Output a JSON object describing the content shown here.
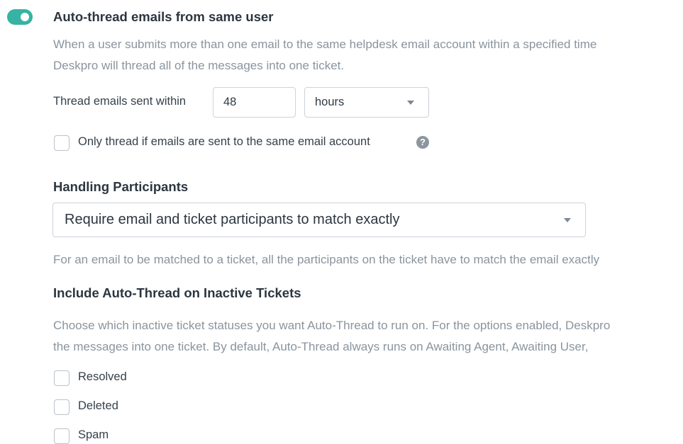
{
  "auto_thread": {
    "enabled": true,
    "title": "Auto-thread emails from same user",
    "description_line1": "When a user submits more than one email to the same helpdesk email account within a specified time",
    "description_line2": "Deskpro will thread all of the messages into one ticket.",
    "within_label": "Thread emails sent within",
    "within_value": "48",
    "unit_selected": "hours",
    "same_account_label": "Only thread if emails are sent to the same email account",
    "same_account_checked": false,
    "help_icon": "question-circle-icon",
    "help_glyph": "?"
  },
  "handling_participants": {
    "title": "Handling Participants",
    "selected_option": "Require email and ticket participants to match exactly",
    "description": "For an email to be matched to a ticket, all the participants on the ticket have to match the email exactly"
  },
  "inactive_tickets": {
    "title": "Include Auto-Thread on Inactive Tickets",
    "description_line1": "Choose which inactive ticket statuses you want Auto-Thread to run on. For the options enabled, Deskpro",
    "description_line2": "the messages into one ticket. By default, Auto-Thread always runs on Awaiting Agent, Awaiting User,",
    "options": [
      {
        "label": "Resolved",
        "checked": false
      },
      {
        "label": "Deleted",
        "checked": false
      },
      {
        "label": "Spam",
        "checked": false
      }
    ]
  },
  "colors": {
    "accent": "#36b3a3",
    "muted_text": "#8a949e",
    "border": "#ccd3da"
  }
}
